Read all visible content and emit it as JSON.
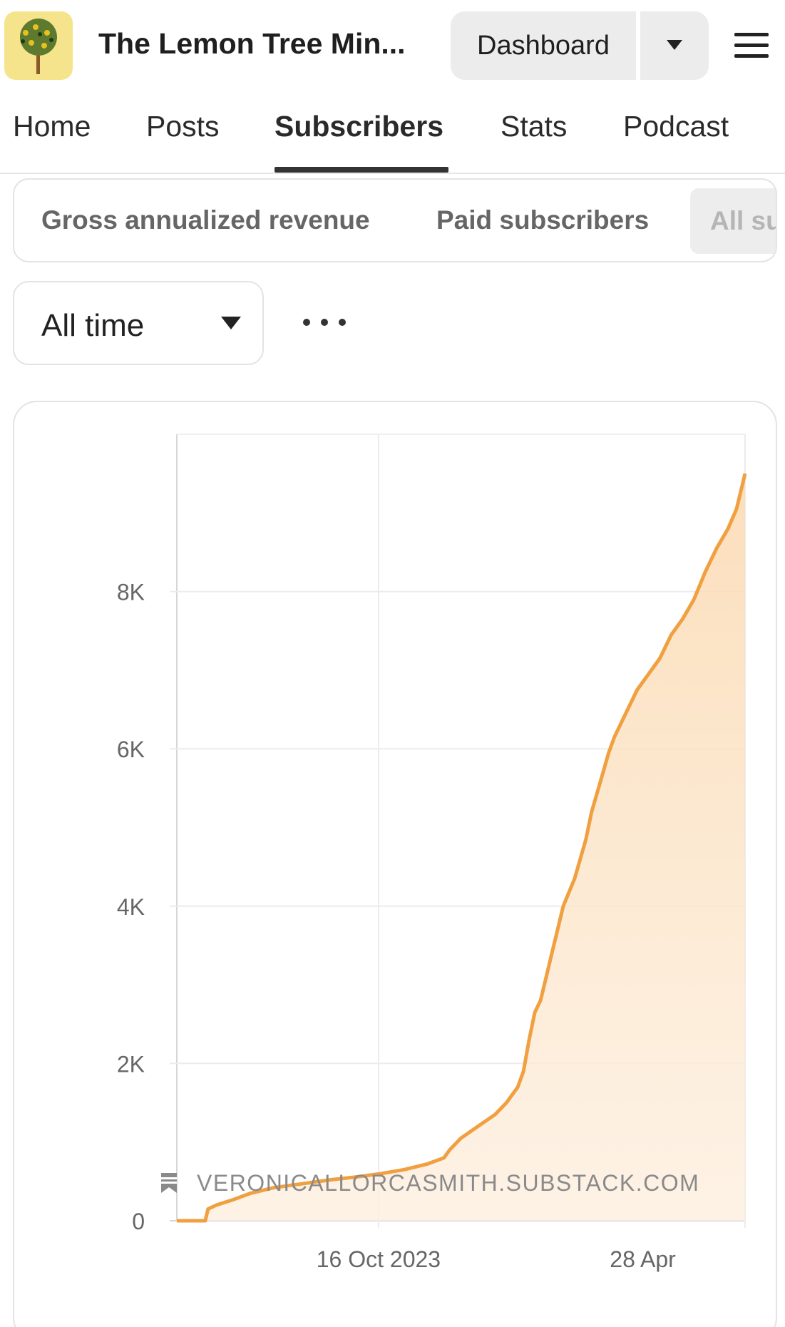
{
  "header": {
    "title": "The Lemon Tree Min...",
    "logo_icon": "lemon-tree-icon",
    "dashboard_label": "Dashboard",
    "menu_icon": "hamburger-menu-icon"
  },
  "tabs": [
    {
      "label": "Home",
      "active": false
    },
    {
      "label": "Posts",
      "active": false
    },
    {
      "label": "Subscribers",
      "active": true
    },
    {
      "label": "Stats",
      "active": false
    },
    {
      "label": "Podcast",
      "active": false
    }
  ],
  "metrics": [
    {
      "label": "Gross annualized revenue"
    },
    {
      "label": "Paid subscribers"
    },
    {
      "label": "All su"
    }
  ],
  "range": {
    "label": "All time",
    "more_icon": "more-horizontal-icon"
  },
  "colors": {
    "accent": "#f0a040",
    "fill": "#fbe3c8"
  },
  "watermark": {
    "text": "VERONICALLORCASMITH.SUBSTACK.COM",
    "icon": "bookmark-icon"
  },
  "chart_data": {
    "type": "area",
    "y_ticks": [
      "0",
      "2K",
      "4K",
      "6K",
      "8K"
    ],
    "x_ticks": [
      "16 Oct 2023",
      "28 Apr"
    ],
    "ylim": [
      0,
      10000
    ],
    "grid": true,
    "series": [
      {
        "points": [
          [
            0.0,
            0
          ],
          [
            0.05,
            0
          ],
          [
            0.055,
            150
          ],
          [
            0.07,
            200
          ],
          [
            0.1,
            270
          ],
          [
            0.13,
            350
          ],
          [
            0.17,
            420
          ],
          [
            0.22,
            470
          ],
          [
            0.27,
            520
          ],
          [
            0.32,
            560
          ],
          [
            0.36,
            600
          ],
          [
            0.4,
            650
          ],
          [
            0.44,
            720
          ],
          [
            0.47,
            800
          ],
          [
            0.48,
            900
          ],
          [
            0.5,
            1050
          ],
          [
            0.53,
            1200
          ],
          [
            0.56,
            1350
          ],
          [
            0.58,
            1500
          ],
          [
            0.6,
            1700
          ],
          [
            0.61,
            1900
          ],
          [
            0.62,
            2300
          ],
          [
            0.63,
            2650
          ],
          [
            0.64,
            2800
          ],
          [
            0.65,
            3100
          ],
          [
            0.66,
            3400
          ],
          [
            0.67,
            3700
          ],
          [
            0.68,
            4000
          ],
          [
            0.7,
            4350
          ],
          [
            0.71,
            4600
          ],
          [
            0.72,
            4850
          ],
          [
            0.73,
            5200
          ],
          [
            0.74,
            5450
          ],
          [
            0.75,
            5700
          ],
          [
            0.76,
            5950
          ],
          [
            0.77,
            6150
          ],
          [
            0.79,
            6450
          ],
          [
            0.81,
            6750
          ],
          [
            0.83,
            6950
          ],
          [
            0.85,
            7150
          ],
          [
            0.87,
            7450
          ],
          [
            0.89,
            7650
          ],
          [
            0.91,
            7900
          ],
          [
            0.93,
            8250
          ],
          [
            0.95,
            8550
          ],
          [
            0.97,
            8800
          ],
          [
            0.985,
            9050
          ],
          [
            1.0,
            9500
          ]
        ]
      }
    ]
  }
}
